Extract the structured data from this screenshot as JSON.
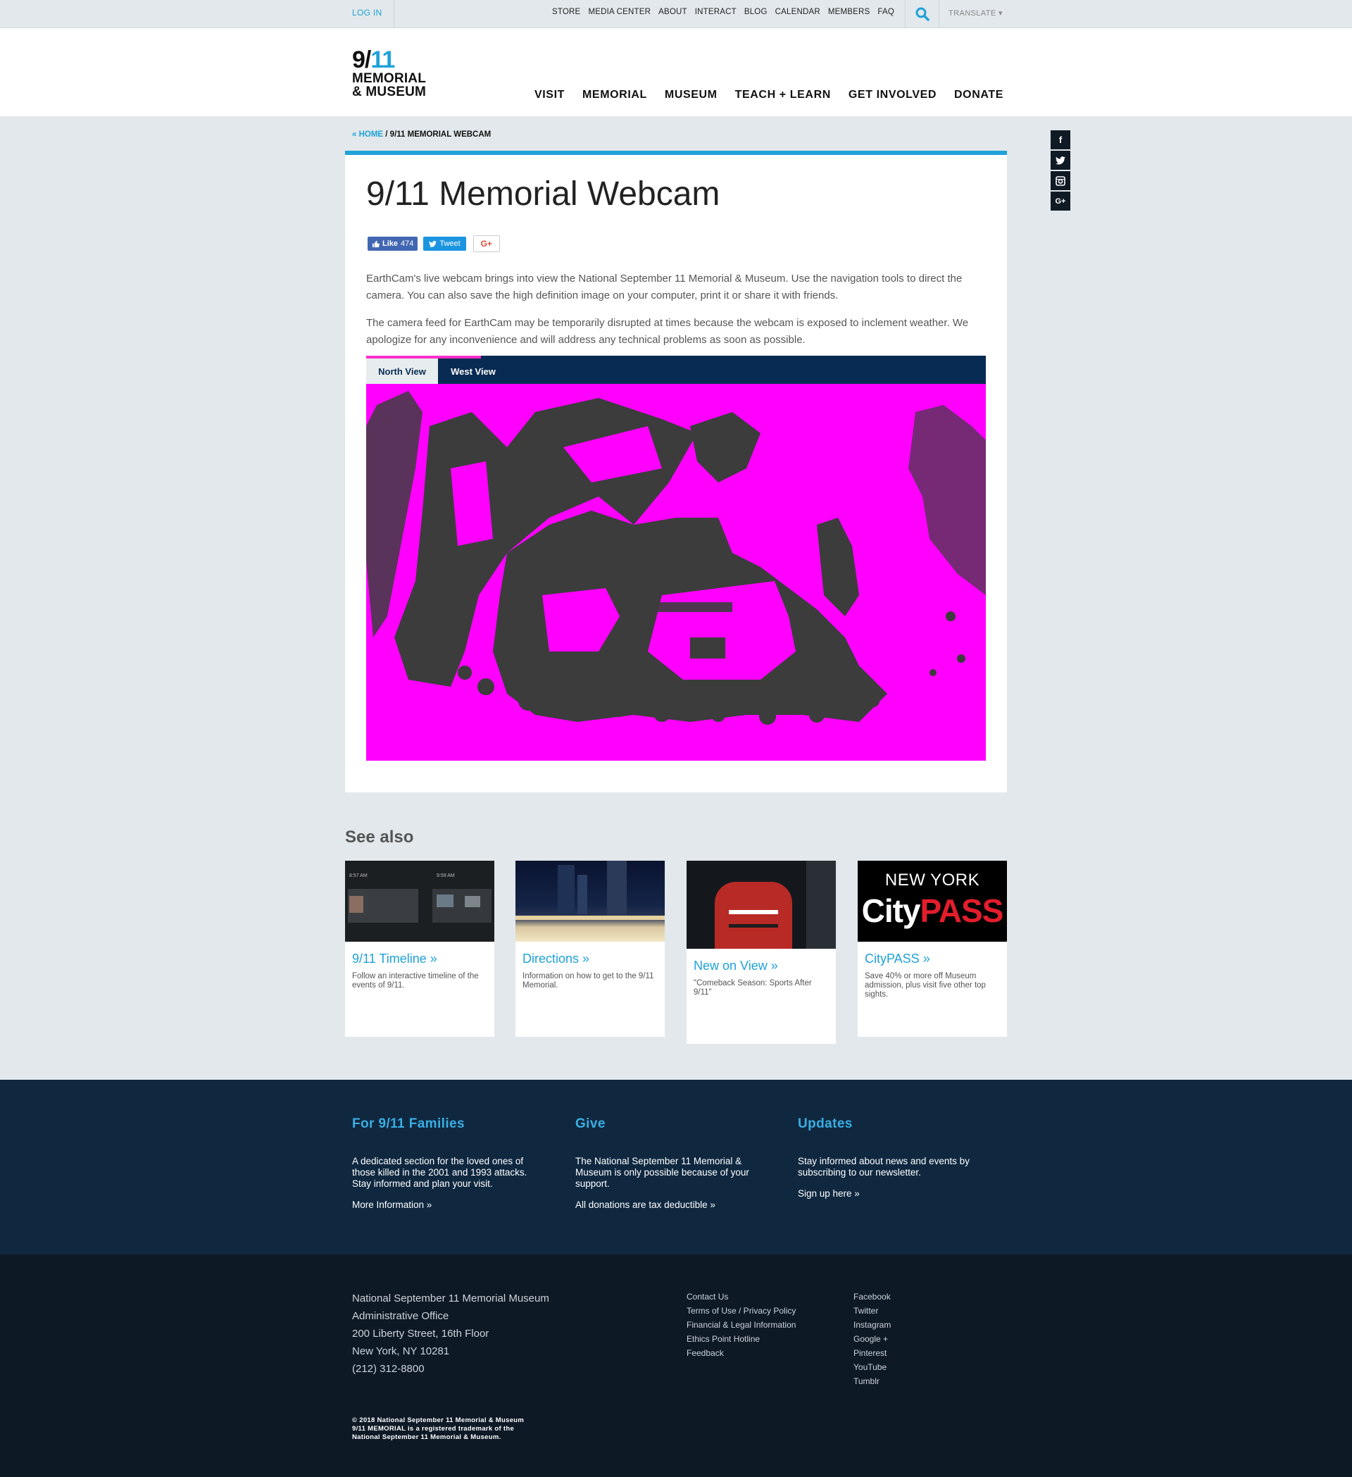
{
  "utility": {
    "login": "LOG IN",
    "links": [
      "STORE",
      "MEDIA CENTER",
      "ABOUT",
      "INTERACT",
      "BLOG",
      "CALENDAR",
      "MEMBERS",
      "FAQ"
    ],
    "translate": "TRANSLATE ▾"
  },
  "logo": {
    "line1a": "9/",
    "line1b": "11",
    "line2": "MEMORIAL",
    "line3": "& MUSEUM"
  },
  "nav": [
    "VISIT",
    "MEMORIAL",
    "MUSEUM",
    "TEACH + LEARN",
    "GET INVOLVED",
    "DONATE"
  ],
  "breadcrumb": {
    "home": "« HOME",
    "current": " / 9/11 MEMORIAL WEBCAM"
  },
  "social": [
    "f",
    "t",
    "ig",
    "G+"
  ],
  "page": {
    "title": "9/11 Memorial Webcam",
    "share": {
      "like": "Like",
      "like_count": "474",
      "tweet": "Tweet",
      "gplus": "G+"
    },
    "p1": "EarthCam's live webcam brings into view the National September 11 Memorial & Museum. Use the navigation tools to direct the camera. You can also save the high definition image on your computer, print it or share it with friends.",
    "p2": "The camera feed for EarthCam may be temporarily disrupted at times because the webcam is exposed to inclement weather. We apologize for any inconvenience and will address any technical problems as soon as possible.",
    "tabs": [
      "North View",
      "West View"
    ]
  },
  "seealso": {
    "heading": "See also",
    "tiles": [
      {
        "title": "9/11 Timeline »",
        "desc": "Follow an interactive timeline of the events of 9/11."
      },
      {
        "title": "Directions »",
        "desc": "Information on how to get to the 9/11 Memorial."
      },
      {
        "title": "New on View »",
        "desc": "\"Comeback Season: Sports After 9/11\""
      },
      {
        "title": "CityPASS »",
        "desc": "Save 40% or more off Museum admission, plus visit five other top sights."
      }
    ],
    "citypass": {
      "line1": "NEW YORK",
      "city": "City",
      "pass": "PASS"
    },
    "timeline": {
      "t1": "8:57 AM",
      "t2": "9:59 AM"
    }
  },
  "footer": {
    "cols": [
      {
        "title": "For 9/11 Families",
        "text": "A dedicated section for the loved ones of those killed in the 2001 and 1993 attacks. Stay informed and plan your visit.",
        "link": "More Information »"
      },
      {
        "title": "Give",
        "text": "The National September 11 Memorial & Museum is only possible because of your support.",
        "link": "All donations are tax deductible »"
      },
      {
        "title": "Updates",
        "text": "Stay informed about news and events by subscribing to our newsletter.",
        "link": "Sign up here »"
      }
    ],
    "address": [
      "National September 11 Memorial Museum",
      "Administrative Office",
      "200 Liberty Street, 16th Floor",
      "New York, NY 10281",
      "(212) 312-8800"
    ],
    "links1": [
      "Contact Us",
      "Terms of Use / Privacy Policy",
      "Financial & Legal Information",
      "Ethics Point Hotline",
      "Feedback"
    ],
    "links2": [
      "Facebook",
      "Twitter",
      "Instagram",
      "Google +",
      "Pinterest",
      "YouTube",
      "Tumblr"
    ],
    "copyright": [
      "© 2018 National September 11 Memorial & Museum",
      "9/11 MEMORIAL is a registered trademark of the",
      "National September 11 Memorial & Museum."
    ]
  },
  "colors": {
    "accent": "#1fa2d8",
    "navy": "#082b53",
    "magenta": "#ff00ff",
    "tab_accent": "#ff2ec9",
    "footer_top": "#0f2840",
    "footer_bottom": "#0e1926"
  },
  "icons": {
    "search": "search-icon",
    "facebook": "facebook-icon",
    "twitter": "twitter-icon",
    "instagram": "instagram-icon",
    "gplus": "google-plus-icon"
  }
}
